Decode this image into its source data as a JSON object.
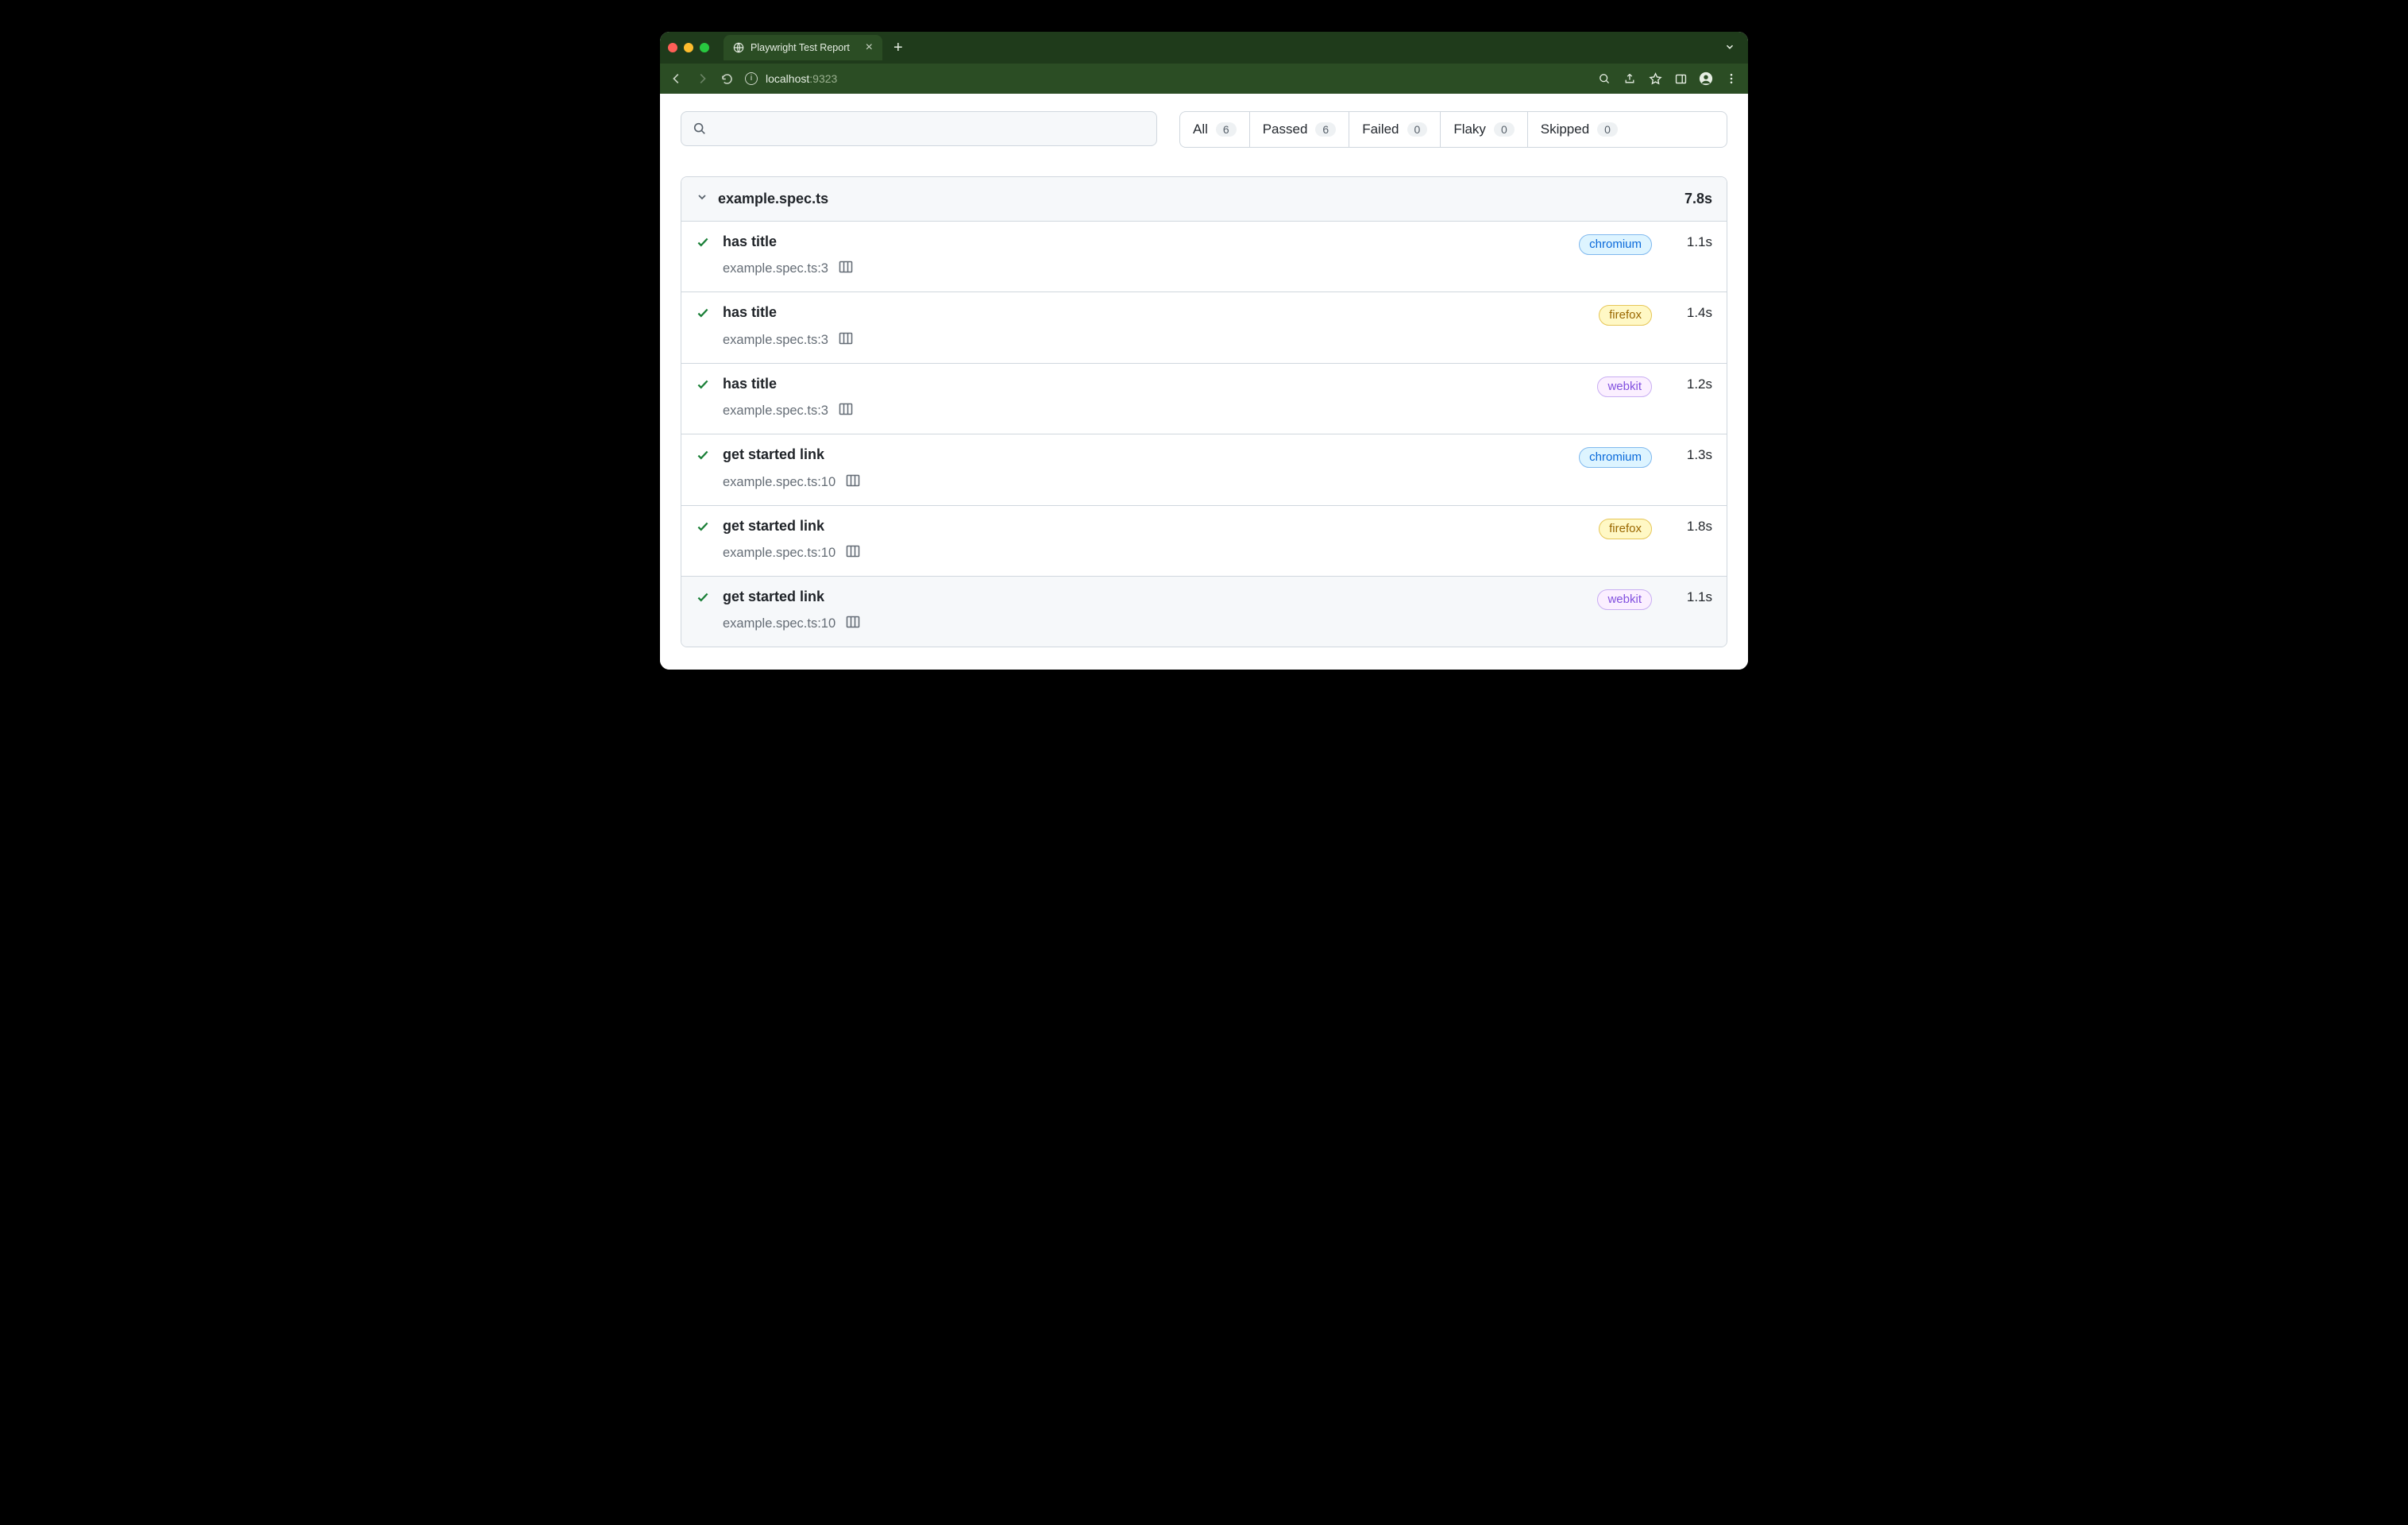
{
  "browser": {
    "tab_title": "Playwright Test Report",
    "url_host": "localhost",
    "url_port": ":9323"
  },
  "filters": {
    "all": {
      "label": "All",
      "count": "6"
    },
    "passed": {
      "label": "Passed",
      "count": "6"
    },
    "failed": {
      "label": "Failed",
      "count": "0"
    },
    "flaky": {
      "label": "Flaky",
      "count": "0"
    },
    "skipped": {
      "label": "Skipped",
      "count": "0"
    }
  },
  "file": {
    "name": "example.spec.ts",
    "duration": "7.8s"
  },
  "tests": [
    {
      "title": "has title",
      "loc": "example.spec.ts:3",
      "browser": "chromium",
      "dur": "1.1s"
    },
    {
      "title": "has title",
      "loc": "example.spec.ts:3",
      "browser": "firefox",
      "dur": "1.4s"
    },
    {
      "title": "has title",
      "loc": "example.spec.ts:3",
      "browser": "webkit",
      "dur": "1.2s"
    },
    {
      "title": "get started link",
      "loc": "example.spec.ts:10",
      "browser": "chromium",
      "dur": "1.3s"
    },
    {
      "title": "get started link",
      "loc": "example.spec.ts:10",
      "browser": "firefox",
      "dur": "1.8s"
    },
    {
      "title": "get started link",
      "loc": "example.spec.ts:10",
      "browser": "webkit",
      "dur": "1.1s"
    }
  ]
}
